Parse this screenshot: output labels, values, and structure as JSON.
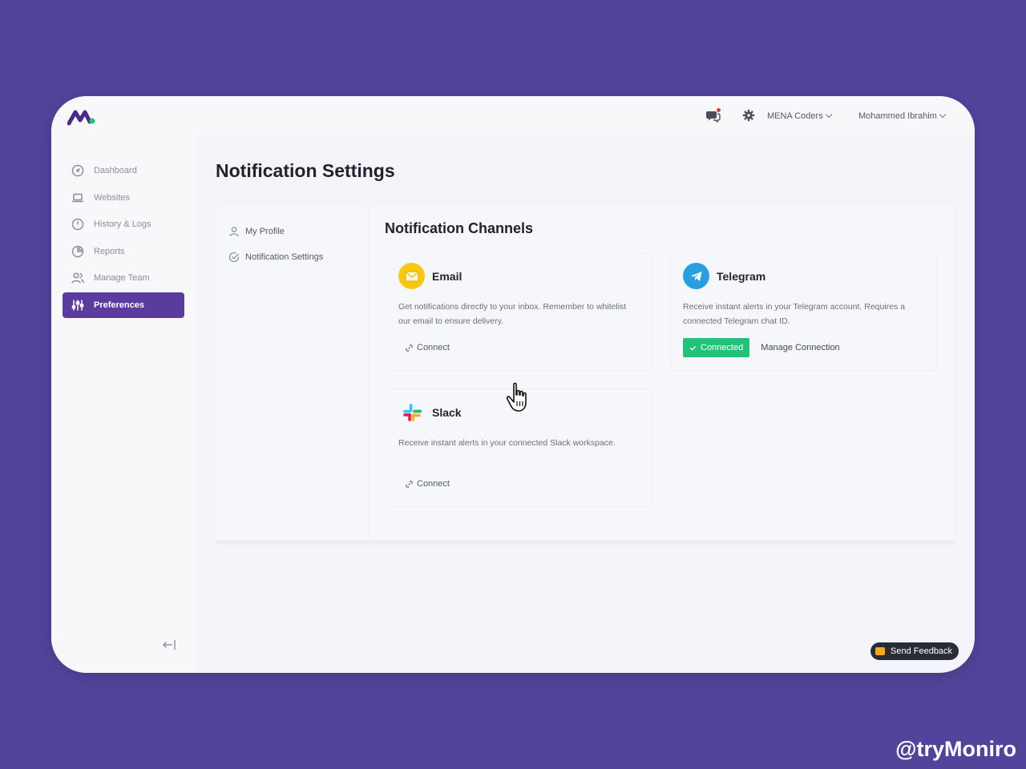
{
  "app": {
    "logo_icon": "moniro-logo-icon",
    "brand_color": "#5c3b9e",
    "accent_color": "#22c27a"
  },
  "sidebar": {
    "items": [
      {
        "label": "Dashboard",
        "icon": "gauge-icon"
      },
      {
        "label": "Websites",
        "icon": "laptop-icon"
      },
      {
        "label": "History & Logs",
        "icon": "alert-circle-icon"
      },
      {
        "label": "Reports",
        "icon": "pie-chart-icon"
      },
      {
        "label": "Manage Team",
        "icon": "users-icon"
      },
      {
        "label": "Preferences",
        "icon": "sliders-icon",
        "active": true
      }
    ],
    "collapse_icon": "collapse-left-icon"
  },
  "topbar": {
    "org": "MENA Coders",
    "user": "Mohammed Ibrahim"
  },
  "page": {
    "title": "Notification Settings"
  },
  "subnav": {
    "items": [
      {
        "label": "My Profile",
        "icon": "user-icon"
      },
      {
        "label": "Notification Settings",
        "icon": "check-circle-icon"
      }
    ]
  },
  "channels": {
    "title": "Notification Channels",
    "email": {
      "name": "Email",
      "description": "Get notifications directly to your inbox. Remember to whitelist our email to ensure delivery.",
      "connect_label": "Connect"
    },
    "telegram": {
      "name": "Telegram",
      "description": "Receive instant alerts in your Telegram account. Requires a connected Telegram chat ID.",
      "connected_label": "Connected",
      "manage_label": "Manage Connection"
    },
    "slack": {
      "name": "Slack",
      "description": "Receive instant alerts in your connected Slack workspace.",
      "connect_label": "Connect"
    }
  },
  "feedback": {
    "label": "Send Feedback"
  },
  "watermark": "@tryMoniro"
}
